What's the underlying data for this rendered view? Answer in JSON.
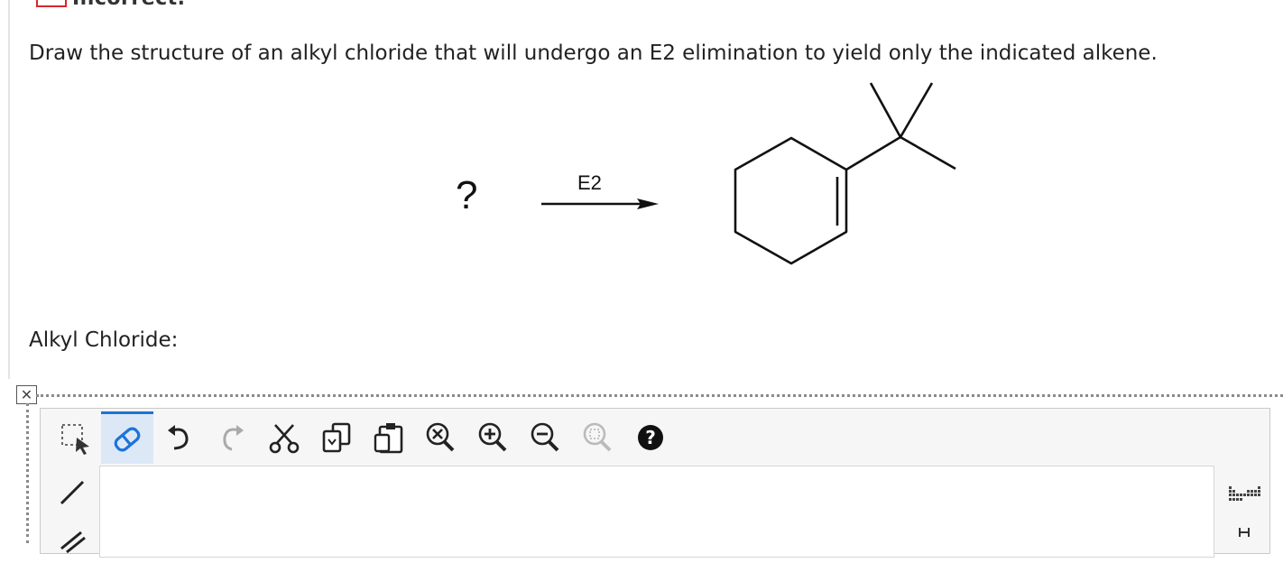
{
  "status": {
    "label": "Incorrect."
  },
  "question": {
    "text": "Draw the structure of an alkyl chloride that will undergo an E2 elimination to yield only the indicated alkene."
  },
  "reaction": {
    "reactant": "?",
    "reagent": "E2"
  },
  "answer": {
    "label": "Alkyl Chloride:"
  },
  "editor": {
    "toolbar": [
      {
        "icon": "selection-icon"
      },
      {
        "icon": "eraser-icon",
        "active": true
      },
      {
        "icon": "undo-icon"
      },
      {
        "icon": "redo-icon"
      },
      {
        "icon": "cut-icon"
      },
      {
        "icon": "copy-icon"
      },
      {
        "icon": "paste-icon"
      },
      {
        "icon": "clear-icon"
      },
      {
        "icon": "zoom-in-icon"
      },
      {
        "icon": "zoom-out-icon"
      },
      {
        "icon": "zoom-fit-icon"
      },
      {
        "icon": "help-icon"
      }
    ],
    "side_tools": [
      {
        "icon": "single-bond-icon"
      },
      {
        "icon": "chain-icon"
      }
    ],
    "right_tools": [
      {
        "icon": "periodic-table-icon"
      },
      {
        "icon": "hydrogen-icon"
      }
    ]
  },
  "colors": {
    "accent": "#1c74d9",
    "error": "#d9262c",
    "help": "#111111"
  }
}
